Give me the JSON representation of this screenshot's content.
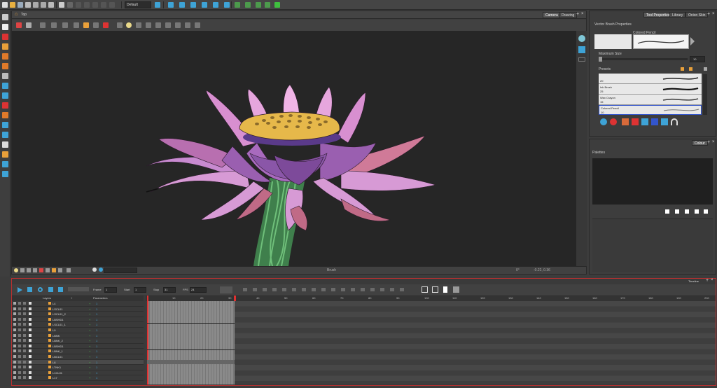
{
  "colors": {
    "accent": "#3ea3d6",
    "timeline_border": "#b83030",
    "playhead": "#e03030",
    "selection": "#3355cc"
  },
  "toolbar": {
    "preset": "Default"
  },
  "view": {
    "tab_label": "Top",
    "tabs": [
      "Camera",
      "Drawing"
    ],
    "status_center": "Brush",
    "status_zoom": "0°",
    "status_coords": "-0.22, 0.36"
  },
  "tool_properties": {
    "tabs": [
      "Tool Properties",
      "Library",
      "Onion Skin"
    ],
    "section": "Vector Brush Properties",
    "brush_name": "Colored Pencil",
    "max_size_label": "Maximum Size",
    "max_size_value": "10",
    "presets_label": "Presets",
    "presets": [
      {
        "name": "",
        "size": "20"
      },
      {
        "name": "Ink Brush",
        "size": "25"
      },
      {
        "name": "Wax Crayon",
        "size": "15"
      },
      {
        "name": "Colored Pencil",
        "size": "10"
      }
    ]
  },
  "colour": {
    "tab": "Colour",
    "palettes_label": "Palettes"
  },
  "timeline": {
    "tab": "Timeline",
    "frame_label": "Frame",
    "frame_value": "1",
    "start_label": "Start",
    "start_value": "1",
    "stop_label": "Stop",
    "stop_value": "31",
    "fps_label": "FPS",
    "fps_value": "24",
    "layers_header": "Layers",
    "params_header": "Parameters",
    "ruler": [
      "10",
      "20",
      "30",
      "40",
      "50",
      "60",
      "70",
      "80",
      "90",
      "100",
      "110",
      "120",
      "130",
      "140",
      "150",
      "160",
      "170",
      "180",
      "190",
      "200"
    ],
    "layers": [
      {
        "name": "L4",
        "value": "1"
      },
      {
        "name": "LSCL01",
        "value": "1"
      },
      {
        "name": "LSCL01_2",
        "value": "1"
      },
      {
        "name": "LBSHD1",
        "value": "1"
      },
      {
        "name": "LSCL01_1",
        "value": "1"
      },
      {
        "name": "L0",
        "value": "1"
      },
      {
        "name": "LBNK",
        "value": "1"
      },
      {
        "name": "LBNK_2",
        "value": "1"
      },
      {
        "name": "LBSHD1",
        "value": "1"
      },
      {
        "name": "LBNK_1",
        "value": "1"
      },
      {
        "name": "LBCL01",
        "value": "1"
      },
      {
        "name": "L8",
        "value": "1"
      },
      {
        "name": "LTNK1",
        "value": "1"
      },
      {
        "name": "L1CL01",
        "value": "1"
      },
      {
        "name": "L17",
        "value": "1"
      }
    ]
  }
}
